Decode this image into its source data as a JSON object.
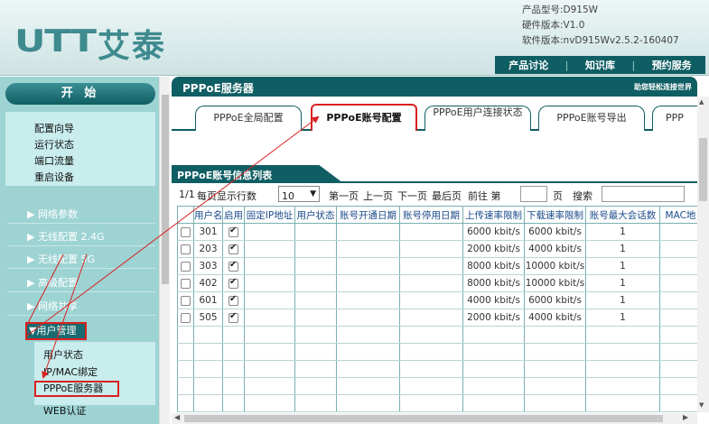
{
  "brand": {
    "logo_mark": "UTT",
    "logo_text": "艾泰"
  },
  "device": {
    "model": "产品型号:D915W",
    "hw": "硬件版本:V1.0",
    "sw": "软件版本:nvD915Wv2.5.2-160407"
  },
  "top_links": [
    "产品讨论",
    "知识库",
    "预约服务"
  ],
  "sidebar": {
    "start": "开 始",
    "items": [
      "配置向导",
      "运行状态",
      "端口流量",
      "重启设备"
    ],
    "groups": [
      "▶ 网络参数",
      "▶ 无线配置 2.4G",
      "▶ 无线配置 5G",
      "▶ 高级配置",
      "▶ 网络共享"
    ],
    "user_mgmt": "▼用户管理",
    "user_items": [
      "用户状态",
      "IP/MAC绑定",
      "PPPoE服务器",
      "WEB认证"
    ]
  },
  "main": {
    "title": "PPPoE服务器",
    "slogan": "助您轻松连接世界",
    "tabs": [
      "PPPoE全局配置",
      "PPPoE账号配置",
      "PPPoE用户连接状态",
      "PPPoE账号导出",
      "PPP"
    ],
    "list_title": "PPPoE账号信息列表"
  },
  "pager": {
    "page_info": "1/1",
    "per_page_label": "每页显示行数",
    "per_page_value": "10",
    "first": "第一页",
    "prev": "上一页",
    "next": "下一页",
    "last": "最后页",
    "goto": "前往 第",
    "page_unit": "页",
    "search": "搜索"
  },
  "table": {
    "headers": [
      "",
      "用户名",
      "启用",
      "固定IP地址",
      "用户状态",
      "账号开通日期",
      "账号停用日期",
      "上传速率限制",
      "下载速率限制",
      "账号最大会话数",
      "MAC地"
    ],
    "rows": [
      {
        "user": "301",
        "enabled": true,
        "up": "6000 kbit/s",
        "down": "6000 kbit/s",
        "max": "1"
      },
      {
        "user": "203",
        "enabled": true,
        "up": "2000 kbit/s",
        "down": "4000 kbit/s",
        "max": "1"
      },
      {
        "user": "303",
        "enabled": true,
        "up": "8000 kbit/s",
        "down": "10000 kbit/s",
        "max": "1"
      },
      {
        "user": "402",
        "enabled": true,
        "up": "8000 kbit/s",
        "down": "10000 kbit/s",
        "max": "1"
      },
      {
        "user": "601",
        "enabled": true,
        "up": "4000 kbit/s",
        "down": "6000 kbit/s",
        "max": "1"
      },
      {
        "user": "505",
        "enabled": true,
        "up": "2000 kbit/s",
        "down": "4000 kbit/s",
        "max": "1"
      }
    ],
    "empty_rows": 5
  },
  "colors": {
    "accent": "#0f5e63",
    "highlight": "#d92020",
    "sidebar": "#9dd3d3"
  }
}
